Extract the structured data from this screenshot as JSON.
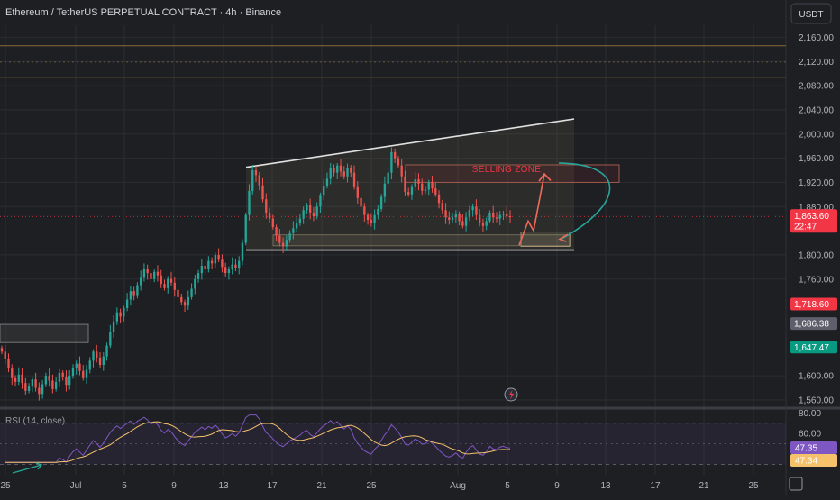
{
  "header": {
    "title": "Ethereum / TetherUS PERPETUAL CONTRACT · 4h · Binance",
    "currency_button": "USDT"
  },
  "colors": {
    "background": "#1e1f22",
    "up": "#26a69a",
    "down": "#ef5350",
    "rsi_line": "#7e57c2",
    "rsi_ma": "#f5c26b",
    "channel": "#e0e0e0",
    "selling_zone": "#f23645",
    "arrow": "#26a69a"
  },
  "chart_data": {
    "type": "candlestick",
    "y_axis": {
      "ticks": [
        "2,160.00",
        "2,120.00",
        "2,080.00",
        "2,040.00",
        "2,000.00",
        "1,960.00",
        "1,920.00",
        "1,880.00",
        "1,800.00",
        "1,760.00",
        "1,600.00",
        "1,560.00"
      ],
      "tick_values": [
        2160,
        2120,
        2080,
        2040,
        2000,
        1960,
        1920,
        1880,
        1800,
        1760,
        1600,
        1560
      ],
      "range": [
        1548,
        2180
      ]
    },
    "x_axis": {
      "ticks": [
        "25",
        "Jul",
        "5",
        "9",
        "13",
        "17",
        "21",
        "25",
        "Aug",
        "5",
        "9",
        "13",
        "17",
        "21",
        "25"
      ]
    },
    "price_tags": [
      {
        "label": "1,863.60",
        "sub": "22:47",
        "value": 1863.6,
        "color": "#f23645"
      },
      {
        "label": "1,718.60",
        "value": 1718.6,
        "color": "#f23645"
      },
      {
        "label": "1,686.38",
        "value": 1686.38,
        "color": "#5d606b"
      },
      {
        "label": "1,647.47",
        "value": 1647.47,
        "color": "#089981"
      }
    ],
    "horizontal_lines": [
      2146,
      2119,
      2094
    ],
    "selling_zone": {
      "label": "SELLING ZONE",
      "top": 1949,
      "bottom": 1920
    },
    "channel": {
      "upper_start": 1945,
      "upper_end": 2025,
      "lower": 1808
    },
    "rsi": {
      "label": "RSI (14, close)",
      "ticks": [
        "80.00",
        "60.00"
      ],
      "tick_values": [
        80,
        60
      ],
      "current_tags": [
        "47.35",
        "47.34"
      ],
      "upper_band": 70,
      "lower_band": 30,
      "range": [
        20,
        82
      ]
    },
    "series": [
      {
        "name": "price",
        "close": [
          1640,
          1628,
          1612,
          1596,
          1590,
          1602,
          1588,
          1575,
          1582,
          1594,
          1580,
          1570,
          1586,
          1600,
          1592,
          1578,
          1590,
          1605,
          1598,
          1585,
          1600,
          1612,
          1620,
          1608,
          1596,
          1610,
          1625,
          1640,
          1630,
          1618,
          1632,
          1650,
          1672,
          1690,
          1705,
          1698,
          1712,
          1726,
          1740,
          1732,
          1750,
          1762,
          1776,
          1770,
          1760,
          1772,
          1766,
          1752,
          1745,
          1760,
          1754,
          1742,
          1730,
          1722,
          1716,
          1730,
          1744,
          1760,
          1770,
          1782,
          1776,
          1790,
          1786,
          1800,
          1792,
          1780,
          1770,
          1776,
          1784,
          1778,
          1790,
          1820,
          1866,
          1906,
          1940,
          1932,
          1915,
          1892,
          1870,
          1860,
          1846,
          1832,
          1820,
          1814,
          1825,
          1836,
          1844,
          1852,
          1860,
          1874,
          1882,
          1870,
          1864,
          1880,
          1898,
          1914,
          1926,
          1944,
          1936,
          1948,
          1938,
          1930,
          1944,
          1936,
          1912,
          1894,
          1880,
          1866,
          1858,
          1852,
          1866,
          1876,
          1896,
          1918,
          1936,
          1970,
          1960,
          1948,
          1930,
          1904,
          1900,
          1912,
          1925,
          1918,
          1906,
          1908,
          1920,
          1910,
          1900,
          1886,
          1874,
          1862,
          1858,
          1862,
          1868,
          1856,
          1848,
          1862,
          1874,
          1880,
          1866,
          1852,
          1848,
          1856,
          1870,
          1862,
          1860,
          1866,
          1868,
          1864,
          1863.6
        ],
        "last": 1863.6
      }
    ]
  }
}
